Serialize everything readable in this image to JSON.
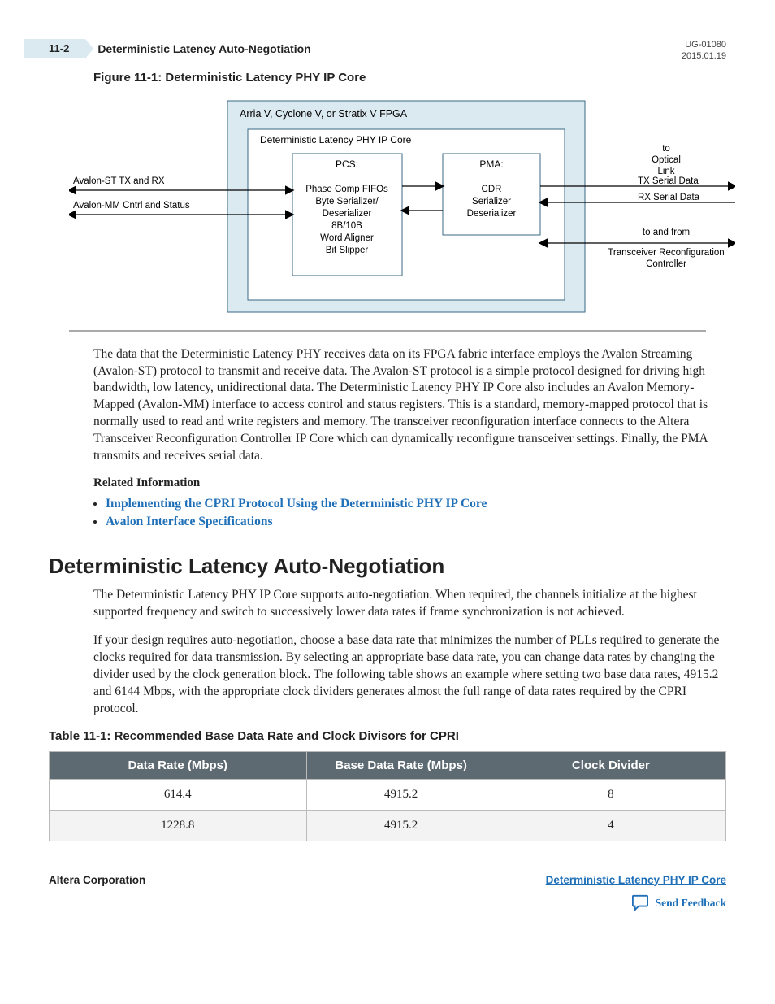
{
  "header": {
    "page_num": "11-2",
    "title": "Deterministic Latency Auto-Negotiation",
    "doc_id": "UG-01080",
    "date": "2015.01.19"
  },
  "figure": {
    "caption": "Figure 11-1: Deterministic Latency PHY IP Core",
    "labels": {
      "fpga": "Arria V, Cyclone V, or Stratix V FPGA",
      "core": "Deterministic Latency PHY IP Core",
      "pcs_title": "PCS:",
      "pcs_l1": "Phase Comp FIFOs",
      "pcs_l2": "Byte Serializer/",
      "pcs_l3": "Deserializer",
      "pcs_l4": "8B/10B",
      "pcs_l5": "Word Aligner",
      "pcs_l6": "Bit Slipper",
      "pma_title": "PMA:",
      "pma_l1": "CDR",
      "pma_l2": "Serializer",
      "pma_l3": "Deserializer",
      "left_top": "Avalon-ST TX and RX",
      "left_bot": "Avalon-MM Cntrl and Status",
      "right_top1": "to",
      "right_top2": "Optical",
      "right_top3": "Link",
      "right_tx": "TX Serial Data",
      "right_rx": "RX Serial Data",
      "right_bot1": "to and from",
      "right_bot2": "Transceiver Reconfiguration",
      "right_bot3": "Controller"
    }
  },
  "body": {
    "p1": "The data that the Deterministic Latency PHY receives data on its FPGA fabric interface employs the Avalon Streaming (Avalon-ST) protocol to transmit and receive data. The Avalon-ST protocol is a simple protocol designed for driving high bandwidth, low latency, unidirectional data. The Deterministic Latency PHY IP Core also includes an Avalon Memory-Mapped (Avalon-MM) interface to access control and status registers. This is a standard, memory-mapped protocol that is normally used to read and write registers and memory. The transceiver reconfiguration interface connects to the Altera Transceiver Reconfiguration Controller IP Core which can dynamically reconfigure transceiver settings. Finally, the PMA transmits and receives serial data.",
    "rel_info_h": "Related Information",
    "links": [
      "Implementing the CPRI Protocol Using the Deterministic PHY IP Core",
      "Avalon Interface Specifications"
    ]
  },
  "section": {
    "title": "Deterministic Latency Auto-Negotiation",
    "p1": "The Deterministic Latency PHY IP Core supports auto-negotiation. When required, the channels initialize at the highest supported frequency and switch to successively lower data rates if frame synchronization is not achieved.",
    "p2": "If your design requires auto-negotiation, choose a base data rate that minimizes the number of PLLs required to generate the clocks required for data transmission. By selecting an appropriate base data rate, you can change data rates by changing the divider used by the clock generation block. The following table shows an example where setting two base data rates, 4915.2 and 6144 Mbps, with the appropriate clock dividers generates almost the full range of data rates required by the CPRI protocol."
  },
  "table": {
    "caption": "Table 11-1: Recommended Base Data Rate and Clock Divisors for CPRI",
    "headers": [
      "Data Rate (Mbps)",
      "Base Data Rate (Mbps)",
      "Clock Divider"
    ],
    "rows": [
      [
        "614.4",
        "4915.2",
        "8"
      ],
      [
        "1228.8",
        "4915.2",
        "4"
      ]
    ]
  },
  "footer": {
    "left": "Altera Corporation",
    "right_link": "Deterministic Latency PHY IP Core",
    "feedback": "Send Feedback"
  }
}
